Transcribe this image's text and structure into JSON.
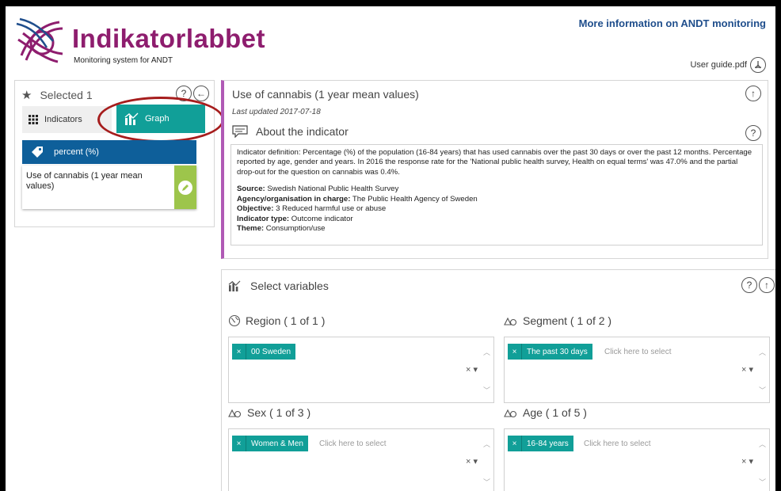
{
  "header": {
    "logo_title": "Indikatorlabbet",
    "logo_subtitle": "Monitoring system for ANDT",
    "more_info_link": "More information on ANDT monitoring",
    "user_guide": "User guide.pdf",
    "brand_color": "#8e1d6e",
    "link_color": "#1f4e8c"
  },
  "selected_panel": {
    "title": "Selected 1",
    "tabs": [
      {
        "label": "Indicators",
        "icon": "grid-icon",
        "active": false
      },
      {
        "label": "Graph",
        "icon": "bar-chart-icon",
        "active": true
      }
    ],
    "unit_label": "percent (%)",
    "selected_item": "Use of cannabis (1 year mean values)",
    "accent_color": "#119f98",
    "unit_color": "#0e5f9a",
    "edit_color": "#9dc54b"
  },
  "indicator": {
    "title": "Use of cannabis (1 year mean values)",
    "last_updated": "Last updated 2017-07-18",
    "about_title": "About the indicator",
    "definition": "Indicator definition: Percentage (%) of the population (16-84 years) that has used cannabis over the past 30 days or over the past 12 months. Percentage reported by age, gender and years. In 2016 the response rate for the 'National public health survey, Health on equal terms' was 47.0% and the partial drop-out for the question on cannabis was 0.4%.",
    "source_label": "Source:",
    "source_value": "Swedish National Public Health Survey",
    "agency_label": "Agency/organisation in charge:",
    "agency_value": "The Public Health Agency of Sweden",
    "objective_label": "Objective:",
    "objective_value": "3 Reduced harmful use or abuse",
    "type_label": "Indicator type:",
    "type_value": "Outcome indicator",
    "theme_label": "Theme:",
    "theme_value": "Consumption/use",
    "accent_color": "#b05ab5"
  },
  "variables": {
    "title": "Select variables",
    "clear_symbol": "× ▾",
    "groups": [
      {
        "label": "Region ( 1 of 1 )",
        "chip": "00 Sweden",
        "placeholder": ""
      },
      {
        "label": "Segment ( 1 of 2 )",
        "chip": "The past 30 days",
        "placeholder": "Click here to select"
      },
      {
        "label": "Sex ( 1 of 3 )",
        "chip": "Women & Men",
        "placeholder": "Click here to select"
      },
      {
        "label": "Age ( 1 of 5 )",
        "chip": "16-84 years",
        "placeholder": "Click here to select"
      }
    ]
  }
}
